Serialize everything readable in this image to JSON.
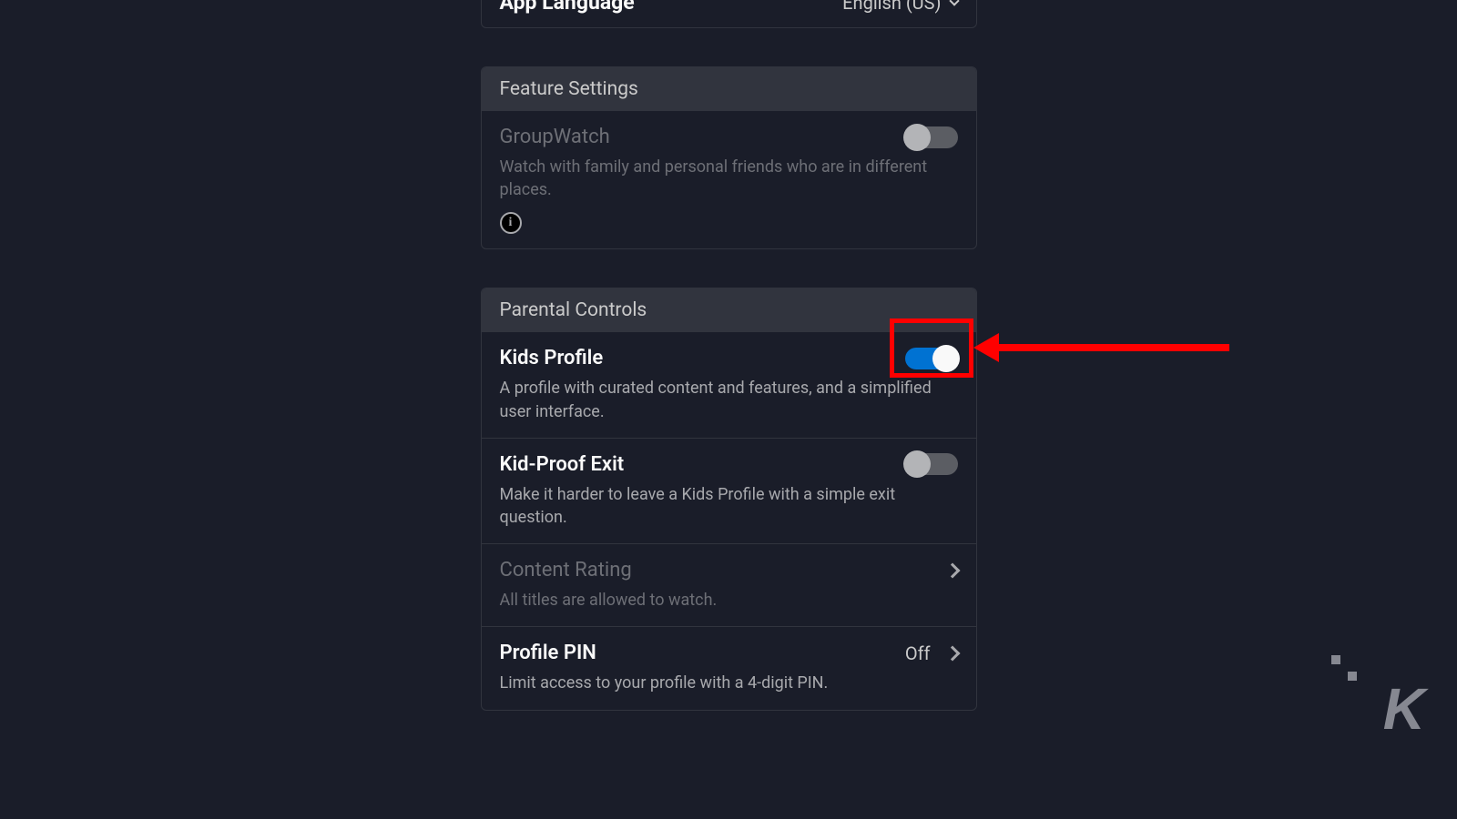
{
  "language": {
    "label": "App Language",
    "value": "English (US)"
  },
  "featureSettings": {
    "header": "Feature Settings",
    "groupWatch": {
      "title": "GroupWatch",
      "description": "Watch with family and personal friends who are in different places.",
      "enabled": false
    }
  },
  "parentalControls": {
    "header": "Parental Controls",
    "kidsProfile": {
      "title": "Kids Profile",
      "description": "A profile with curated content and features, and a simplified user interface.",
      "enabled": true
    },
    "kidProofExit": {
      "title": "Kid-Proof Exit",
      "description": "Make it harder to leave a Kids Profile with a simple exit question.",
      "enabled": false
    },
    "contentRating": {
      "title": "Content Rating",
      "description": "All titles are allowed to watch."
    },
    "profilePin": {
      "title": "Profile PIN",
      "status": "Off",
      "description": "Limit access to your profile with a 4-digit PIN."
    }
  },
  "annotation": {
    "highlightTarget": "kids-profile-toggle"
  },
  "watermark": "K"
}
